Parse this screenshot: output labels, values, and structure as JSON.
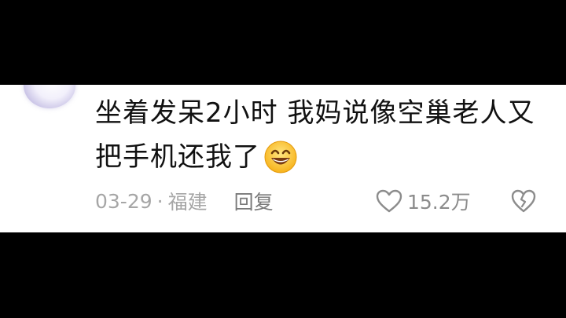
{
  "comment": {
    "line1": "坐着发呆2小时 我妈说像空巢老人又",
    "line2": "把手机还我了",
    "emoji": "grinning-face-emoji"
  },
  "meta": {
    "date": "03-29",
    "separator": "·",
    "location": "福建",
    "reply_label": "回复"
  },
  "actions": {
    "like_icon": "heart-outline-icon",
    "like_count": "15.2万",
    "dislike_icon": "broken-heart-icon"
  },
  "colors": {
    "background": "#000000",
    "card": "#ffffff",
    "text": "#111111",
    "meta_text": "#a6a6a6"
  }
}
